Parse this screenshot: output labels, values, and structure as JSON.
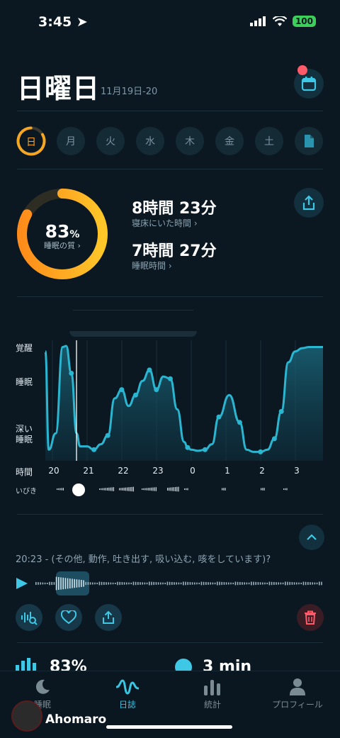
{
  "status": {
    "time": "3:45",
    "battery": "100"
  },
  "header": {
    "day": "日曜日",
    "date_range": "11月19日-20"
  },
  "week": {
    "days": [
      "日",
      "月",
      "火",
      "水",
      "木",
      "金",
      "土"
    ]
  },
  "summary": {
    "quality_value": "83",
    "quality_unit": "%",
    "quality_label": "睡眠の質 ›",
    "quality_fraction": 0.83,
    "time_in_bed_value": "8時間 23分",
    "time_in_bed_label": "寝床にいた時間 ›",
    "sleep_time_value": "7時間 27分",
    "sleep_time_label": "睡眠時間 ›"
  },
  "chart": {
    "y_labels": [
      "覚醒",
      "睡眠",
      "深い\n睡眠"
    ],
    "x_title": "時間",
    "snore_title": "いびき",
    "hours": [
      "20",
      "21",
      "22",
      "23",
      "0",
      "1",
      "2",
      "3"
    ],
    "accent": "#29b7d2"
  },
  "chart_data": {
    "type": "area",
    "x_unit": "hours since 20:00",
    "x": [
      0,
      0.1,
      0.3,
      0.5,
      0.6,
      0.75,
      0.9,
      1.0,
      1.2,
      1.4,
      1.6,
      1.8,
      2.0,
      2.2,
      2.4,
      2.6,
      2.8,
      3.0,
      3.2,
      3.4,
      3.6,
      3.8,
      4.0,
      4.1,
      4.2,
      4.4,
      4.6,
      4.8,
      5.0,
      5.3,
      5.6,
      5.8,
      6.0,
      6.2,
      6.4,
      6.6,
      6.8,
      7.0,
      7.2,
      7.4,
      7.6,
      7.8,
      8.0
    ],
    "y": [
      0.95,
      0.05,
      0.2,
      0.99,
      1.0,
      0.75,
      0.2,
      0.08,
      0.08,
      0.05,
      0.1,
      0.18,
      0.52,
      0.6,
      0.45,
      0.55,
      0.68,
      0.78,
      0.6,
      0.72,
      0.7,
      0.42,
      0.12,
      0.07,
      0.05,
      0.04,
      0.05,
      0.1,
      0.35,
      0.55,
      0.3,
      0.05,
      0.03,
      0.03,
      0.05,
      0.15,
      0.4,
      0.85,
      0.95,
      0.98,
      0.99,
      0.99,
      0.99
    ],
    "y_levels": [
      "深い睡眠",
      "睡眠",
      "覚醒"
    ],
    "grid": true
  },
  "audio": {
    "clip_text": "20:23 - (その他, 動作, 吐き出す, 吸い込む, 咳をしています)?"
  },
  "stats_peek": {
    "left_value": "83%",
    "right_value": "3 min"
  },
  "tabs": [
    {
      "label": "睡眠",
      "icon": "moon-icon"
    },
    {
      "label": "日誌",
      "icon": "pulse-icon"
    },
    {
      "label": "統計",
      "icon": "bars-icon"
    },
    {
      "label": "プロフィール",
      "icon": "person-icon"
    }
  ],
  "watermark": {
    "name": "Ahomaro"
  }
}
